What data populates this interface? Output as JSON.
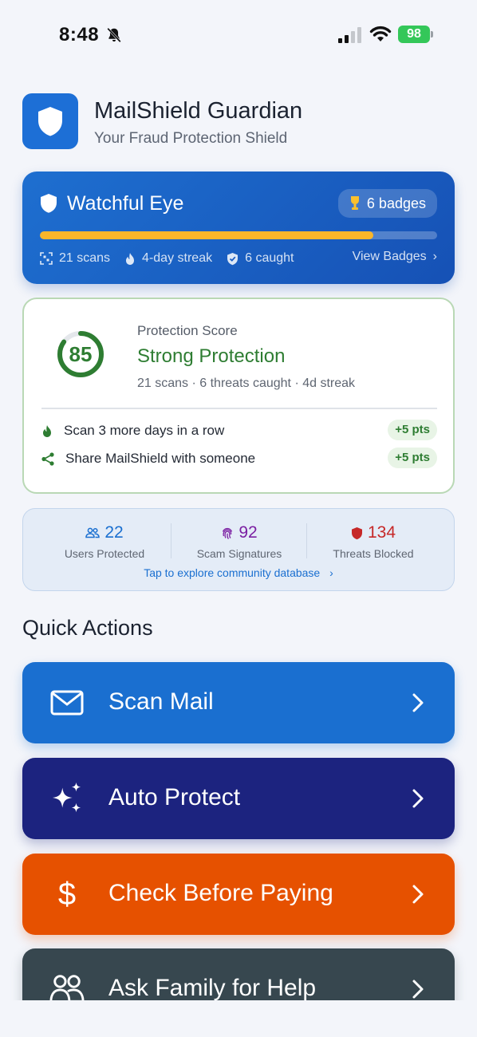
{
  "status_bar": {
    "time": "8:48",
    "battery": "98"
  },
  "header": {
    "title": "MailShield Guardian",
    "subtitle": "Your Fraud Protection Shield"
  },
  "level": {
    "title": "Watchful Eye",
    "badges": "6 badges",
    "progress_percent": 84,
    "scans": "21 scans",
    "streak": "4-day streak",
    "caught": "6 caught",
    "view_badges": "View Badges",
    "view_badges_chevron": "›"
  },
  "score": {
    "value": "85",
    "value_fraction": 0.85,
    "label": "Protection Score",
    "status": "Strong Protection",
    "summary": "21 scans · 6 threats caught · 4d streak",
    "tasks": [
      {
        "text": "Scan 3 more days in a row",
        "points": "+5 pts"
      },
      {
        "text": "Share MailShield with someone",
        "points": "+5 pts"
      }
    ]
  },
  "community": {
    "users": {
      "value": "22",
      "label": "Users Protected"
    },
    "signatures": {
      "value": "92",
      "label": "Scam Signatures"
    },
    "threats": {
      "value": "134",
      "label": "Threats Blocked"
    },
    "link": "Tap to explore community database",
    "link_chevron": "›"
  },
  "quick_actions": {
    "heading": "Quick Actions",
    "items": [
      {
        "label": "Scan Mail"
      },
      {
        "label": "Auto Protect"
      },
      {
        "label": "Check Before Paying",
        "icon_glyph": "$"
      },
      {
        "label": "Ask Family for Help"
      }
    ]
  },
  "colors": {
    "primary": "#1a6fd0",
    "success": "#2e7d32",
    "indigo": "#1c237f",
    "orange": "#e65100",
    "slate": "#37474f",
    "amber": "#fbb62a",
    "threat_red": "#c62828",
    "signature_purple": "#7b1fa2"
  }
}
